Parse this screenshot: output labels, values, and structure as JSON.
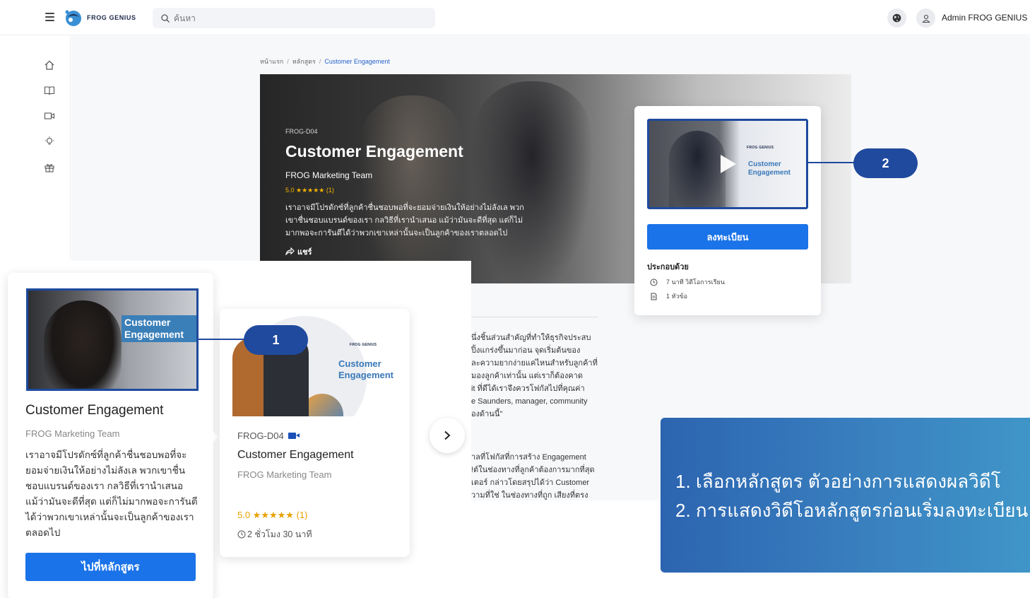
{
  "topbar": {
    "brand": "FROG GENIUS",
    "search_placeholder": "ค้นหา",
    "admin_name": "Admin FROG GENIUS"
  },
  "sidebar": {
    "items": [
      {
        "icon": "home-icon"
      },
      {
        "icon": "book-icon"
      },
      {
        "icon": "video-icon"
      },
      {
        "icon": "lightbulb-icon"
      },
      {
        "icon": "gift-icon"
      }
    ]
  },
  "breadcrumb": {
    "items": [
      "หน้าแรก",
      "หลักสูตร",
      "Customer Engagement"
    ]
  },
  "hero": {
    "code": "FROG-D04",
    "title": "Customer Engagement",
    "team": "FROG Marketing Team",
    "rating": "5.0 ★★★★★ (1)",
    "description": "เราอาจมีโปรดักซ์ที่ลูกค้าชื่นชอบพอที่จะยอมจ่ายเงินให้อย่างไม่ลังเล พวกเขาชื่นชอบแบรนด์ของเรา กลวิธีที่เรานำเสนอ แม้ว่ามันจะดีที่สุด แต่ก็ไม่มากพอจะการันตีได้ว่าพวกเขาเหล่านั้นจะเป็นลูกค้าของเราตลอดไป",
    "share": "แชร์"
  },
  "side_card": {
    "thumb_brand": "FROG GENIUS",
    "thumb_title": "Customer Engagement",
    "enroll_label": "ลงทะเบียน",
    "includes_title": "ประกอบด้วย",
    "includes": [
      {
        "icon": "clock-icon",
        "text": "7 นาที วิดีโอการเรียน"
      },
      {
        "icon": "document-icon",
        "text": "1 หัวข้อ"
      }
    ]
  },
  "annotations": {
    "badge_1": "1",
    "badge_2": "2"
  },
  "about": {
    "lines_a": [
      "นึ่งชิ้นส่วนสำคัญที่ทำให้ธุรกิจประสบ",
      "ปิ้งแกร่งขึ้นมาก่อน จุดเริ่มต้นของ",
      "ละความยากง่ายแค่ไหนสำหรับลูกค้าที่",
      "มองลูกค้าเท่านั้น แต่เราก็ต้องคาด",
      "it ที่ดีได้เราจึงควรโฟกัสไปที่คุณค่า",
      "e Saunders, manager, community",
      "องด้านนี้\""
    ],
    "lines_b": [
      "าลที่โฟกัสที่การสร้าง Engagement",
      "!ต์ในช่องทางที่ลูกค้าต้องการมากที่สุด",
      "เตอร์ กล่าวโดยสรุปได้ว่า Customer",
      "วามที่ใช่ ในช่องทางที่ถูก เสียงที่ตรง"
    ]
  },
  "popup": {
    "thumb_tag": "Customer Engagement",
    "title": "Customer Engagement",
    "team": "FROG Marketing Team",
    "description": "เราอาจมีโปรดักซ์ที่ลูกค้าชื่นชอบพอที่จะยอมจ่ายเงินให้อย่างไม่ลังเล พวกเขาชื่นชอบแบรนด์ของเรา กลวิธีที่เรานำเสนอ แม้ว่ามันจะดีที่สุด แต่ก็ไม่มากพอจะการันตีได้ว่าพวกเขาเหล่านั้นจะเป็นลูกค้าของเราตลอดไป",
    "button_label": "ไปที่หลักสูตร"
  },
  "course_card": {
    "brand": "FROG GENIUS",
    "image_title": "Customer Engagement",
    "code": "FROG-D04",
    "title": "Customer Engagement",
    "team": "FROG Marketing Team",
    "rating": "5.0 ★★★★★ (1)",
    "duration": "2 ชั่วโมง 30 นาที"
  },
  "caption": {
    "line1": "1. เลือกหลักสูตร ตัวอย่างการแสดงผลวิดีโ",
    "line2": "2. การแสดงวิดีโอหลักสูตรก่อนเริ่มลงทะเบียน"
  },
  "colors": {
    "primary": "#1a73e8",
    "annotation": "#1f4a9e",
    "star": "#f5b301"
  }
}
